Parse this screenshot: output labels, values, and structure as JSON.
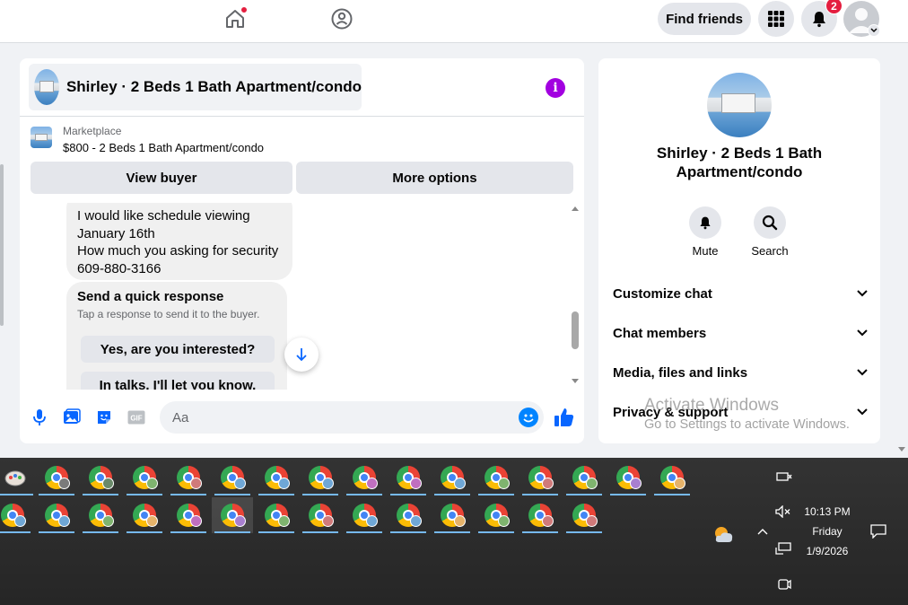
{
  "nav": {
    "find_friends_label": "Find friends",
    "notification_count": "2"
  },
  "chat": {
    "title": "Shirley · 2 Beds 1 Bath Apartment/condo",
    "marketplace_label": "Marketplace",
    "listing": "$800 - 2 Beds 1 Bath Apartment/condo",
    "view_buyer_label": "View buyer",
    "more_options_label": "More options",
    "message_lines": [
      "I would like schedule viewing",
      "January 16th",
      "How much you asking for security",
      "609-880-3166"
    ],
    "quick_response": {
      "title": "Send a quick response",
      "subtitle": "Tap a response to send it to the buyer.",
      "options": [
        "Yes, are you interested?",
        "In talks. I'll let you know."
      ]
    },
    "composer_placeholder": "Aa",
    "gif_label": "GIF"
  },
  "details": {
    "name": "Shirley · 2 Beds 1 Bath Apartment/condo",
    "actions": [
      "Mute",
      "Search"
    ],
    "sections": [
      "Customize chat",
      "Chat members",
      "Media, files and links",
      "Privacy & support"
    ]
  },
  "watermark": {
    "title": "Activate Windows",
    "subtitle": "Go to Settings to activate Windows."
  },
  "taskbar": {
    "time": "10:13 PM",
    "day": "Friday",
    "date": "1/9/2026",
    "badge_colors_row1": [
      "#7b7b7b",
      "#6a8a6a",
      "#7fb46f",
      "#d07a7a",
      "#6fa7d6",
      "#6fa7d6",
      "#6fa7d6",
      "#c06fc0",
      "#c06fc0",
      "#6fa7d6",
      "#7fb46f",
      "#d07a7a",
      "#7fb46f",
      "#a87fd0",
      "#e6b36a"
    ],
    "badge_colors_row2": [
      "#6fa7d6",
      "#6fa7d6",
      "#7fb46f",
      "#e6b36a",
      "#c06fc0",
      "#a87fd0",
      "#7fb46f",
      "#d07a7a",
      "#6fa7d6",
      "#6fa7d6",
      "#e6b36a",
      "#7fb46f",
      "#d07a7a",
      "#d07a7a"
    ]
  },
  "colors": {
    "accent": "#0866ff",
    "info": "#a200e0",
    "notification": "#e41e3f"
  }
}
